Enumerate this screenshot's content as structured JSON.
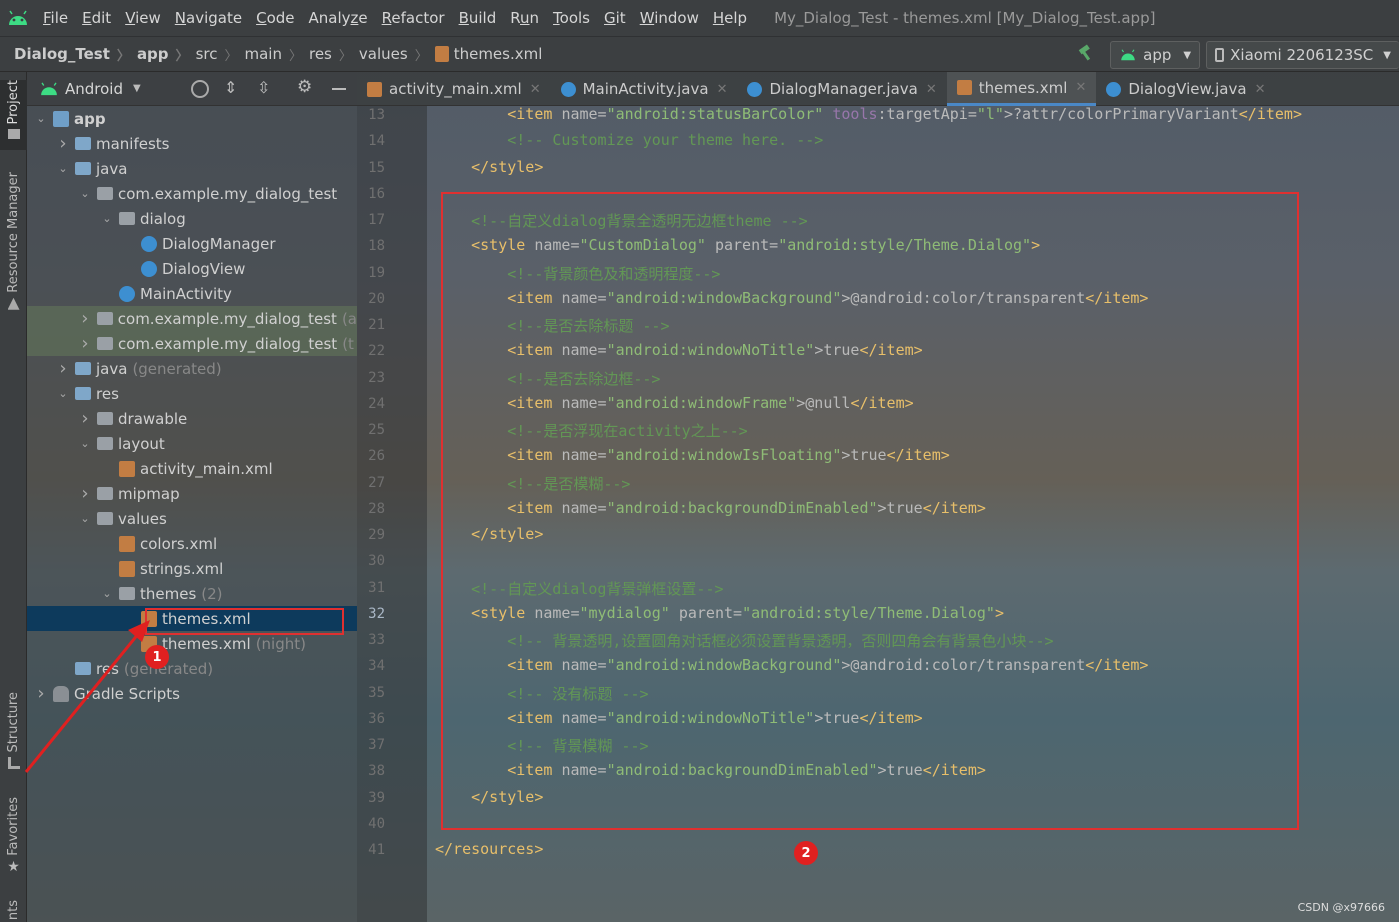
{
  "menubar": {
    "items": [
      {
        "pre": "",
        "u": "F",
        "post": "ile"
      },
      {
        "pre": "",
        "u": "E",
        "post": "dit"
      },
      {
        "pre": "",
        "u": "V",
        "post": "iew"
      },
      {
        "pre": "",
        "u": "N",
        "post": "avigate"
      },
      {
        "pre": "",
        "u": "C",
        "post": "ode"
      },
      {
        "pre": "Analy",
        "u": "z",
        "post": "e"
      },
      {
        "pre": "",
        "u": "R",
        "post": "efactor"
      },
      {
        "pre": "",
        "u": "B",
        "post": "uild"
      },
      {
        "pre": "R",
        "u": "u",
        "post": "n"
      },
      {
        "pre": "",
        "u": "T",
        "post": "ools"
      },
      {
        "pre": "",
        "u": "G",
        "post": "it"
      },
      {
        "pre": "",
        "u": "W",
        "post": "indow"
      },
      {
        "pre": "",
        "u": "H",
        "post": "elp"
      }
    ],
    "title": "My_Dialog_Test - themes.xml [My_Dialog_Test.app]"
  },
  "navbar": {
    "crumbs": [
      "Dialog_Test",
      "app",
      "src",
      "main",
      "res",
      "values",
      "themes.xml"
    ],
    "run_config": "app",
    "device": "Xiaomi 2206123SC"
  },
  "left_tools": {
    "project": "Project",
    "resource_manager": "Resource Manager",
    "structure": "Structure",
    "favorites": "Favorites",
    "bottom": "nts"
  },
  "project": {
    "view_mode": "Android",
    "tree": [
      {
        "label": "app",
        "extra": ""
      },
      {
        "label": "manifests",
        "extra": ""
      },
      {
        "label": "java",
        "extra": ""
      },
      {
        "label": "com.example.my_dialog_test",
        "extra": ""
      },
      {
        "label": "dialog",
        "extra": ""
      },
      {
        "label": "DialogManager",
        "extra": ""
      },
      {
        "label": "DialogView",
        "extra": ""
      },
      {
        "label": "MainActivity",
        "extra": ""
      },
      {
        "label": "com.example.my_dialog_test",
        "extra": "(a"
      },
      {
        "label": "com.example.my_dialog_test",
        "extra": "(t"
      },
      {
        "label": "java",
        "extra": "(generated)"
      },
      {
        "label": "res",
        "extra": ""
      },
      {
        "label": "drawable",
        "extra": ""
      },
      {
        "label": "layout",
        "extra": ""
      },
      {
        "label": "activity_main.xml",
        "extra": ""
      },
      {
        "label": "mipmap",
        "extra": ""
      },
      {
        "label": "values",
        "extra": ""
      },
      {
        "label": "colors.xml",
        "extra": ""
      },
      {
        "label": "strings.xml",
        "extra": ""
      },
      {
        "label": "themes",
        "extra": "(2)"
      },
      {
        "label": "themes.xml",
        "extra": ""
      },
      {
        "label": "themes.xml",
        "extra": "(night)"
      },
      {
        "label": "res",
        "extra": "(generated)"
      },
      {
        "label": "Gradle Scripts",
        "extra": ""
      }
    ]
  },
  "editor": {
    "tabs": [
      {
        "label": "activity_main.xml"
      },
      {
        "label": "MainActivity.java"
      },
      {
        "label": "DialogManager.java"
      },
      {
        "label": "themes.xml"
      },
      {
        "label": "DialogView.java"
      }
    ],
    "line_numbers": [
      "13",
      "14",
      "15",
      "16",
      "17",
      "18",
      "19",
      "20",
      "21",
      "22",
      "23",
      "24",
      "25",
      "26",
      "27",
      "28",
      "29",
      "30",
      "31",
      "32",
      "33",
      "34",
      "35",
      "36",
      "37",
      "38",
      "39",
      "40",
      "41"
    ],
    "lines": [
      [
        [
          "        ",
          ""
        ],
        [
          "<item ",
          "tag"
        ],
        [
          "name=",
          "an"
        ],
        [
          "\"android:statusBarColor\"",
          "av"
        ],
        [
          " ",
          ""
        ],
        [
          "tools",
          "ns"
        ],
        [
          ":targetApi=",
          "an"
        ],
        [
          "\"l\"",
          "av"
        ],
        [
          ">?attr/colorPrimaryVariant",
          "an"
        ],
        [
          "</item>",
          "tag"
        ]
      ],
      [
        [
          "        ",
          ""
        ],
        [
          "<!-- Customize your theme here. -->",
          "cm"
        ]
      ],
      [
        [
          "    ",
          ""
        ],
        [
          "</style>",
          "tag"
        ]
      ],
      [],
      [
        [
          "    ",
          ""
        ],
        [
          "<!--自定义dialog背景全透明无边框theme -->",
          "cm"
        ]
      ],
      [
        [
          "    ",
          ""
        ],
        [
          "<style ",
          "tag"
        ],
        [
          "name=",
          "an"
        ],
        [
          "\"CustomDialog\"",
          "av"
        ],
        [
          " parent=",
          "an"
        ],
        [
          "\"android:style/Theme.Dialog\"",
          "av"
        ],
        [
          ">",
          "tag"
        ]
      ],
      [
        [
          "        ",
          ""
        ],
        [
          "<!--背景颜色及和透明程度-->",
          "cm"
        ]
      ],
      [
        [
          "        ",
          ""
        ],
        [
          "<item ",
          "tag"
        ],
        [
          "name=",
          "an"
        ],
        [
          "\"android:windowBackground\"",
          "av"
        ],
        [
          ">@android:color/transparent",
          "an"
        ],
        [
          "</item>",
          "tag"
        ]
      ],
      [
        [
          "        ",
          ""
        ],
        [
          "<!--是否去除标题 -->",
          "cm"
        ]
      ],
      [
        [
          "        ",
          ""
        ],
        [
          "<item ",
          "tag"
        ],
        [
          "name=",
          "an"
        ],
        [
          "\"android:windowNoTitle\"",
          "av"
        ],
        [
          ">true",
          "an"
        ],
        [
          "</item>",
          "tag"
        ]
      ],
      [
        [
          "        ",
          ""
        ],
        [
          "<!--是否去除边框-->",
          "cm"
        ]
      ],
      [
        [
          "        ",
          ""
        ],
        [
          "<item ",
          "tag"
        ],
        [
          "name=",
          "an"
        ],
        [
          "\"android:windowFrame\"",
          "av"
        ],
        [
          ">@null",
          "an"
        ],
        [
          "</item>",
          "tag"
        ]
      ],
      [
        [
          "        ",
          ""
        ],
        [
          "<!--是否浮现在activity之上-->",
          "cm"
        ]
      ],
      [
        [
          "        ",
          ""
        ],
        [
          "<item ",
          "tag"
        ],
        [
          "name=",
          "an"
        ],
        [
          "\"android:windowIsFloating\"",
          "av"
        ],
        [
          ">true",
          "an"
        ],
        [
          "</item>",
          "tag"
        ]
      ],
      [
        [
          "        ",
          ""
        ],
        [
          "<!--是否模糊-->",
          "cm"
        ]
      ],
      [
        [
          "        ",
          ""
        ],
        [
          "<item ",
          "tag"
        ],
        [
          "name=",
          "an"
        ],
        [
          "\"android:backgroundDimEnabled\"",
          "av"
        ],
        [
          ">true",
          "an"
        ],
        [
          "</item>",
          "tag"
        ]
      ],
      [
        [
          "    ",
          ""
        ],
        [
          "</style>",
          "tag"
        ]
      ],
      [],
      [
        [
          "    ",
          ""
        ],
        [
          "<!--自定义dialog背景弹框设置-->",
          "cm"
        ]
      ],
      [
        [
          "    ",
          ""
        ],
        [
          "<style ",
          "tag"
        ],
        [
          "name=",
          "an"
        ],
        [
          "\"mydialog\"",
          "av"
        ],
        [
          " parent=",
          "an"
        ],
        [
          "\"android:style/Theme.Dialog\"",
          "av"
        ],
        [
          ">",
          "tag"
        ]
      ],
      [
        [
          "        ",
          ""
        ],
        [
          "<!-- 背景透明,设置圆角对话框必须设置背景透明，否则四角会有背景色小块-->",
          "cm"
        ]
      ],
      [
        [
          "        ",
          ""
        ],
        [
          "<item ",
          "tag"
        ],
        [
          "name=",
          "an"
        ],
        [
          "\"android:windowBackground\"",
          "av"
        ],
        [
          ">@android:color/transparent",
          "an"
        ],
        [
          "</item>",
          "tag"
        ]
      ],
      [
        [
          "        ",
          ""
        ],
        [
          "<!-- 没有标题 -->",
          "cm"
        ]
      ],
      [
        [
          "        ",
          ""
        ],
        [
          "<item ",
          "tag"
        ],
        [
          "name=",
          "an"
        ],
        [
          "\"android:windowNoTitle\"",
          "av"
        ],
        [
          ">true",
          "an"
        ],
        [
          "</item>",
          "tag"
        ]
      ],
      [
        [
          "        ",
          ""
        ],
        [
          "<!-- 背景模糊 -->",
          "cm"
        ]
      ],
      [
        [
          "        ",
          ""
        ],
        [
          "<item ",
          "tag"
        ],
        [
          "name=",
          "an"
        ],
        [
          "\"android:backgroundDimEnabled\"",
          "av"
        ],
        [
          ">true",
          "an"
        ],
        [
          "</item>",
          "tag"
        ]
      ],
      [
        [
          "    ",
          ""
        ],
        [
          "</style>",
          "tag"
        ]
      ],
      [],
      [
        [
          "",
          ""
        ],
        [
          "</resources>",
          "tag"
        ]
      ]
    ]
  },
  "annotations": {
    "badge1": "1",
    "badge2": "2"
  },
  "watermark": "CSDN @x97666",
  "colors": {
    "accent": "#4a88c7",
    "annotation_red": "#e03030",
    "tag": "#e8bf6a",
    "attr_value": "#8fbc76",
    "comment": "#629755"
  }
}
